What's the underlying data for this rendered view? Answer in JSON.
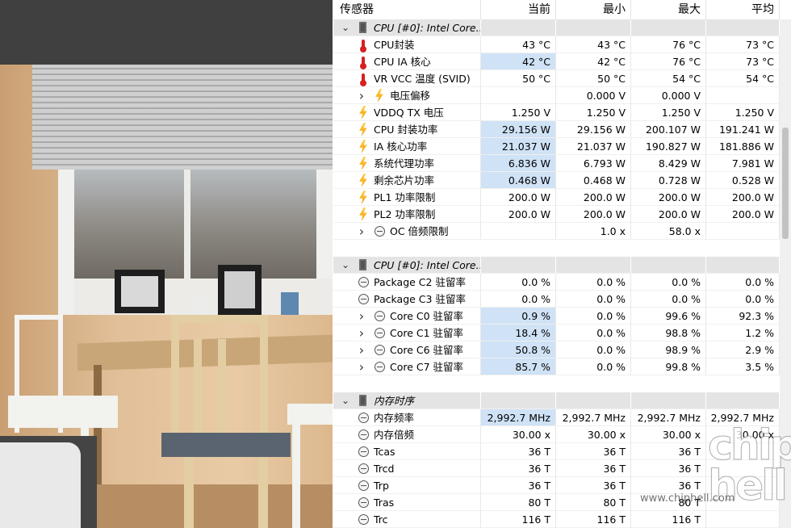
{
  "columns": {
    "sensor": "传感器",
    "current": "当前",
    "min": "最小",
    "max": "最大",
    "avg": "平均"
  },
  "rows": [
    {
      "type": "group",
      "label": "CPU [#0]: Intel Core...",
      "icon": "chip-icon",
      "expander": "expanded"
    },
    {
      "type": "item",
      "label": "CPU封装",
      "icon": "thermometer-icon",
      "cur": "43 °C",
      "min": "43 °C",
      "max": "76 °C",
      "avg": "73 °C"
    },
    {
      "type": "item",
      "label": "CPU IA 核心",
      "icon": "thermometer-icon",
      "cur": "42 °C",
      "min": "42 °C",
      "max": "76 °C",
      "avg": "73 °C",
      "hl": true
    },
    {
      "type": "item",
      "label": "VR VCC 温度 (SVID)",
      "icon": "thermometer-icon",
      "cur": "50 °C",
      "min": "50 °C",
      "max": "54 °C",
      "avg": "54 °C"
    },
    {
      "type": "sub",
      "label": "电压偏移",
      "icon": "bolt-icon",
      "expander": "collapsed",
      "cur": "",
      "min": "0.000 V",
      "max": "0.000 V",
      "avg": ""
    },
    {
      "type": "item",
      "label": "VDDQ TX 电压",
      "icon": "bolt-icon",
      "cur": "1.250 V",
      "min": "1.250 V",
      "max": "1.250 V",
      "avg": "1.250 V"
    },
    {
      "type": "item",
      "label": "CPU 封装功率",
      "icon": "bolt-icon",
      "cur": "29.156 W",
      "min": "29.156 W",
      "max": "200.107 W",
      "avg": "191.241 W",
      "hl": true
    },
    {
      "type": "item",
      "label": "IA 核心功率",
      "icon": "bolt-icon",
      "cur": "21.037 W",
      "min": "21.037 W",
      "max": "190.827 W",
      "avg": "181.886 W",
      "hl": true
    },
    {
      "type": "item",
      "label": "系统代理功率",
      "icon": "bolt-icon",
      "cur": "6.836 W",
      "min": "6.793 W",
      "max": "8.429 W",
      "avg": "7.981 W",
      "hl": true
    },
    {
      "type": "item",
      "label": "剩余芯片功率",
      "icon": "bolt-icon",
      "cur": "0.468 W",
      "min": "0.468 W",
      "max": "0.728 W",
      "avg": "0.528 W",
      "hl": true
    },
    {
      "type": "item",
      "label": "PL1 功率限制",
      "icon": "bolt-icon",
      "cur": "200.0 W",
      "min": "200.0 W",
      "max": "200.0 W",
      "avg": "200.0 W"
    },
    {
      "type": "item",
      "label": "PL2 功率限制",
      "icon": "bolt-icon",
      "cur": "200.0 W",
      "min": "200.0 W",
      "max": "200.0 W",
      "avg": "200.0 W"
    },
    {
      "type": "sub",
      "label": "OC 倍频限制",
      "icon": "clock-icon",
      "expander": "collapsed",
      "cur": "",
      "min": "1.0 x",
      "max": "58.0 x",
      "avg": ""
    },
    {
      "type": "blank"
    },
    {
      "type": "group",
      "label": "CPU [#0]: Intel Core...",
      "icon": "chip-icon",
      "expander": "expanded"
    },
    {
      "type": "item",
      "label": "Package C2 驻留率",
      "icon": "clock-icon",
      "cur": "0.0 %",
      "min": "0.0 %",
      "max": "0.0 %",
      "avg": "0.0 %"
    },
    {
      "type": "item",
      "label": "Package C3 驻留率",
      "icon": "clock-icon",
      "cur": "0.0 %",
      "min": "0.0 %",
      "max": "0.0 %",
      "avg": "0.0 %"
    },
    {
      "type": "sub",
      "label": "Core C0 驻留率",
      "icon": "clock-icon",
      "expander": "collapsed",
      "cur": "0.9 %",
      "min": "0.0 %",
      "max": "99.6 %",
      "avg": "92.3 %",
      "hl": true
    },
    {
      "type": "sub",
      "label": "Core C1 驻留率",
      "icon": "clock-icon",
      "expander": "collapsed",
      "cur": "18.4 %",
      "min": "0.0 %",
      "max": "98.8 %",
      "avg": "1.2 %",
      "hl": true
    },
    {
      "type": "sub",
      "label": "Core C6 驻留率",
      "icon": "clock-icon",
      "expander": "collapsed",
      "cur": "50.8 %",
      "min": "0.0 %",
      "max": "98.9 %",
      "avg": "2.9 %",
      "hl": true
    },
    {
      "type": "sub",
      "label": "Core C7 驻留率",
      "icon": "clock-icon",
      "expander": "collapsed",
      "cur": "85.7 %",
      "min": "0.0 %",
      "max": "99.8 %",
      "avg": "3.5 %",
      "hl": true
    },
    {
      "type": "blank"
    },
    {
      "type": "group",
      "label": "内存时序",
      "icon": "chip-icon",
      "expander": "expanded"
    },
    {
      "type": "item",
      "label": "内存频率",
      "icon": "clock-icon",
      "cur": "2,992.7 MHz",
      "min": "2,992.7 MHz",
      "max": "2,992.7 MHz",
      "avg": "2,992.7 MHz",
      "hl": true
    },
    {
      "type": "item",
      "label": "内存倍频",
      "icon": "clock-icon",
      "cur": "30.00 x",
      "min": "30.00 x",
      "max": "30.00 x",
      "avg": "30.00 x"
    },
    {
      "type": "item",
      "label": "Tcas",
      "icon": "clock-icon",
      "cur": "36 T",
      "min": "36 T",
      "max": "36 T",
      "avg": ""
    },
    {
      "type": "item",
      "label": "Trcd",
      "icon": "clock-icon",
      "cur": "36 T",
      "min": "36 T",
      "max": "36 T",
      "avg": ""
    },
    {
      "type": "item",
      "label": "Trp",
      "icon": "clock-icon",
      "cur": "36 T",
      "min": "36 T",
      "max": "36 T",
      "avg": ""
    },
    {
      "type": "item",
      "label": "Tras",
      "icon": "clock-icon",
      "cur": "80 T",
      "min": "80 T",
      "max": "80 T",
      "avg": ""
    },
    {
      "type": "item",
      "label": "Trc",
      "icon": "clock-icon",
      "cur": "116 T",
      "min": "116 T",
      "max": "116 T",
      "avg": ""
    }
  ],
  "watermark": {
    "logo_line1": "chip",
    "logo_line2": "hell",
    "url": "www.chiphell.com"
  }
}
